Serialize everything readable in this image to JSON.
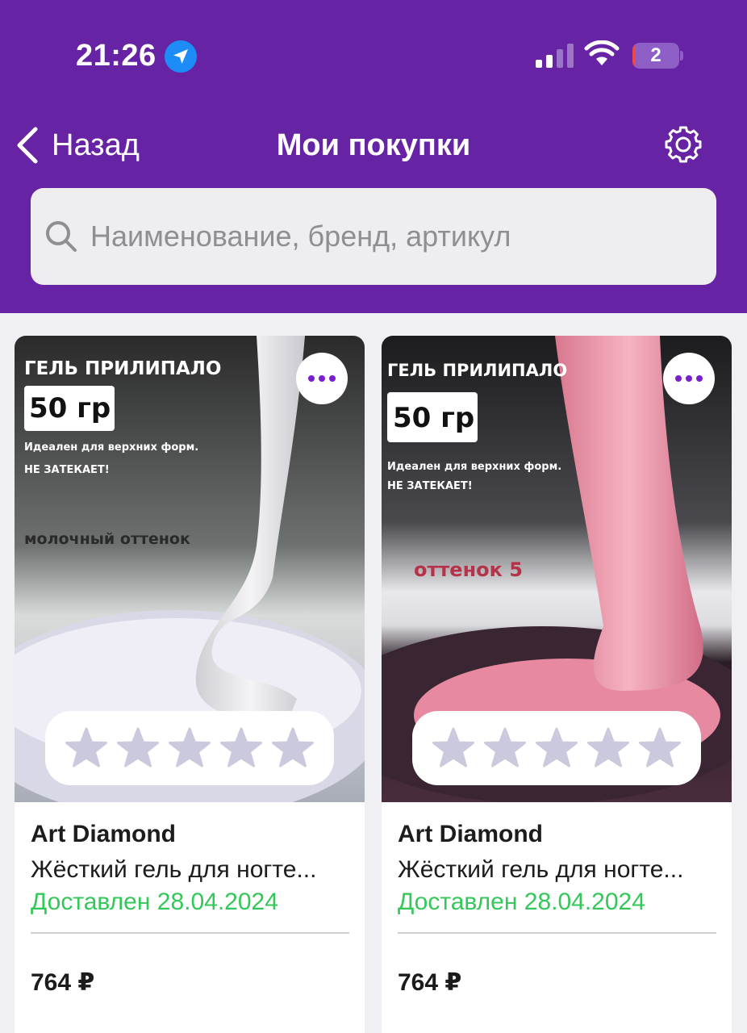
{
  "status_bar": {
    "time": "21:26",
    "battery_level": "2"
  },
  "nav": {
    "back_label": "Назад",
    "title": "Мои покупки",
    "settings_icon": "gear-icon"
  },
  "search": {
    "placeholder": "Наименование, бренд, артикул",
    "value": ""
  },
  "colors": {
    "header": "#6623a3",
    "accent": "#7a1fd0",
    "delivered": "#34c759",
    "star_empty": "#cbc9dd"
  },
  "products": [
    {
      "image": {
        "line1": "ГЕЛЬ ПРИЛИПАЛО",
        "weight": "50 гр",
        "line2": "Идеален для верхних форм.",
        "line3": "НЕ ЗАТЕКАЕТ!",
        "shade": "молочный оттенок"
      },
      "rating": 0,
      "rating_max": 5,
      "brand": "Art Diamond",
      "name": "Жёсткий гель для ногте...",
      "status": "Доставлен 28.04.2024",
      "price": "764 ₽"
    },
    {
      "image": {
        "line1": "ГЕЛЬ ПРИЛИПАЛО",
        "weight": "50 гр",
        "line2": "Идеален для верхних форм.",
        "line3": "НЕ ЗАТЕКАЕТ!",
        "shade": "оттенок 5"
      },
      "rating": 0,
      "rating_max": 5,
      "brand": "Art Diamond",
      "name": "Жёсткий гель для ногте...",
      "status": "Доставлен 28.04.2024",
      "price": "764 ₽"
    }
  ]
}
